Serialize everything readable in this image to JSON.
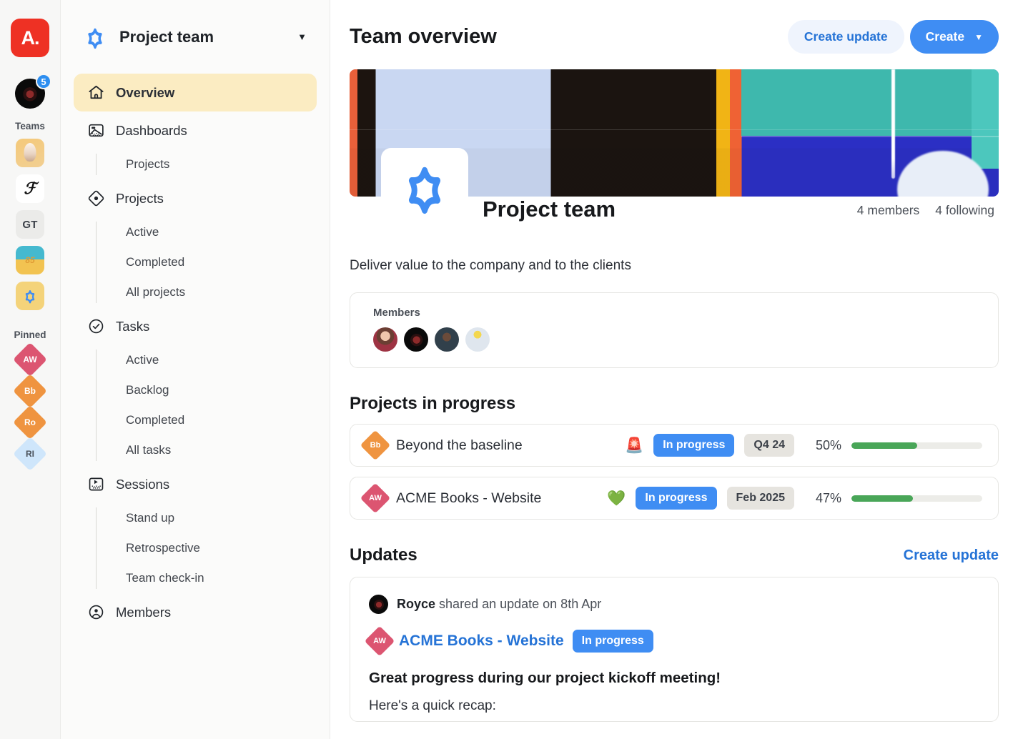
{
  "rail": {
    "brand_label": "A.",
    "user_badge_count": "5",
    "teams_label": "Teams",
    "pinned_label": "Pinned",
    "team_tiles": [
      {
        "name": "ice-cream-team-icon",
        "style": "tile-ice",
        "label": ""
      },
      {
        "name": "f-script-team-icon",
        "style": "tile-f",
        "label": "ℱ"
      },
      {
        "name": "gt-team-icon",
        "style": "tile-gt",
        "label": "GT"
      },
      {
        "name": "beach-team-icon",
        "style": "tile-beach",
        "label": "85"
      },
      {
        "name": "project-team-icon",
        "style": "tile-star",
        "label": ""
      }
    ],
    "pinned_items": [
      {
        "label": "AW",
        "style": "d-aw"
      },
      {
        "label": "Bb",
        "style": "d-bb"
      },
      {
        "label": "Ro",
        "style": "d-ro"
      },
      {
        "label": "RI",
        "style": "d-ri"
      }
    ]
  },
  "sidebar": {
    "team_name": "Project team",
    "nav": [
      {
        "label": "Overview",
        "icon": "home-icon",
        "active": true,
        "children": []
      },
      {
        "label": "Dashboards",
        "icon": "dashboard-icon",
        "active": false,
        "children": [
          "Projects"
        ]
      },
      {
        "label": "Projects",
        "icon": "target-icon",
        "active": false,
        "children": [
          "Active",
          "Completed",
          "All projects"
        ]
      },
      {
        "label": "Tasks",
        "icon": "check-circle-icon",
        "active": false,
        "children": [
          "Active",
          "Backlog",
          "Completed",
          "All tasks"
        ]
      },
      {
        "label": "Sessions",
        "icon": "sessions-icon",
        "active": false,
        "children": [
          "Stand up",
          "Retrospective",
          "Team check-in"
        ]
      },
      {
        "label": "Members",
        "icon": "person-icon",
        "active": false,
        "children": []
      }
    ]
  },
  "header": {
    "title": "Team overview",
    "create_update_label": "Create update",
    "create_label": "Create"
  },
  "team": {
    "name": "Project team",
    "members_count": "4 members",
    "following_count": "4 following",
    "tagline": "Deliver value to the company and to the clients",
    "members_label": "Members",
    "member_avatars": [
      "av1",
      "av2",
      "av3",
      "av4"
    ]
  },
  "projects_section": {
    "title": "Projects in progress",
    "rows": [
      {
        "initials": "Bb",
        "color": "#ef9440",
        "name": "Beyond the baseline",
        "emoji": "🚨",
        "status": "In progress",
        "due": "Q4 24",
        "percent_label": "50%",
        "percent": 50
      },
      {
        "initials": "AW",
        "color": "#dc5571",
        "name": "ACME Books - Website",
        "emoji": "💚",
        "status": "In progress",
        "due": "Feb 2025",
        "percent_label": "47%",
        "percent": 47
      }
    ]
  },
  "updates_section": {
    "title": "Updates",
    "create_update_link": "Create update",
    "update": {
      "author": "Royce",
      "meta": "shared an update on 8th Apr",
      "project_initials": "AW",
      "project_name": "ACME Books - Website",
      "status": "In progress",
      "headline": "Great progress during our project kickoff meeting!",
      "body": "Here's a quick recap:"
    }
  },
  "colors": {
    "brand_red": "#ee3124",
    "accent_blue": "#3f8df3",
    "link_blue": "#2573d6",
    "active_nav": "#fbecc2",
    "progress_green": "#49a658",
    "badge_gray": "#e6e4df"
  }
}
